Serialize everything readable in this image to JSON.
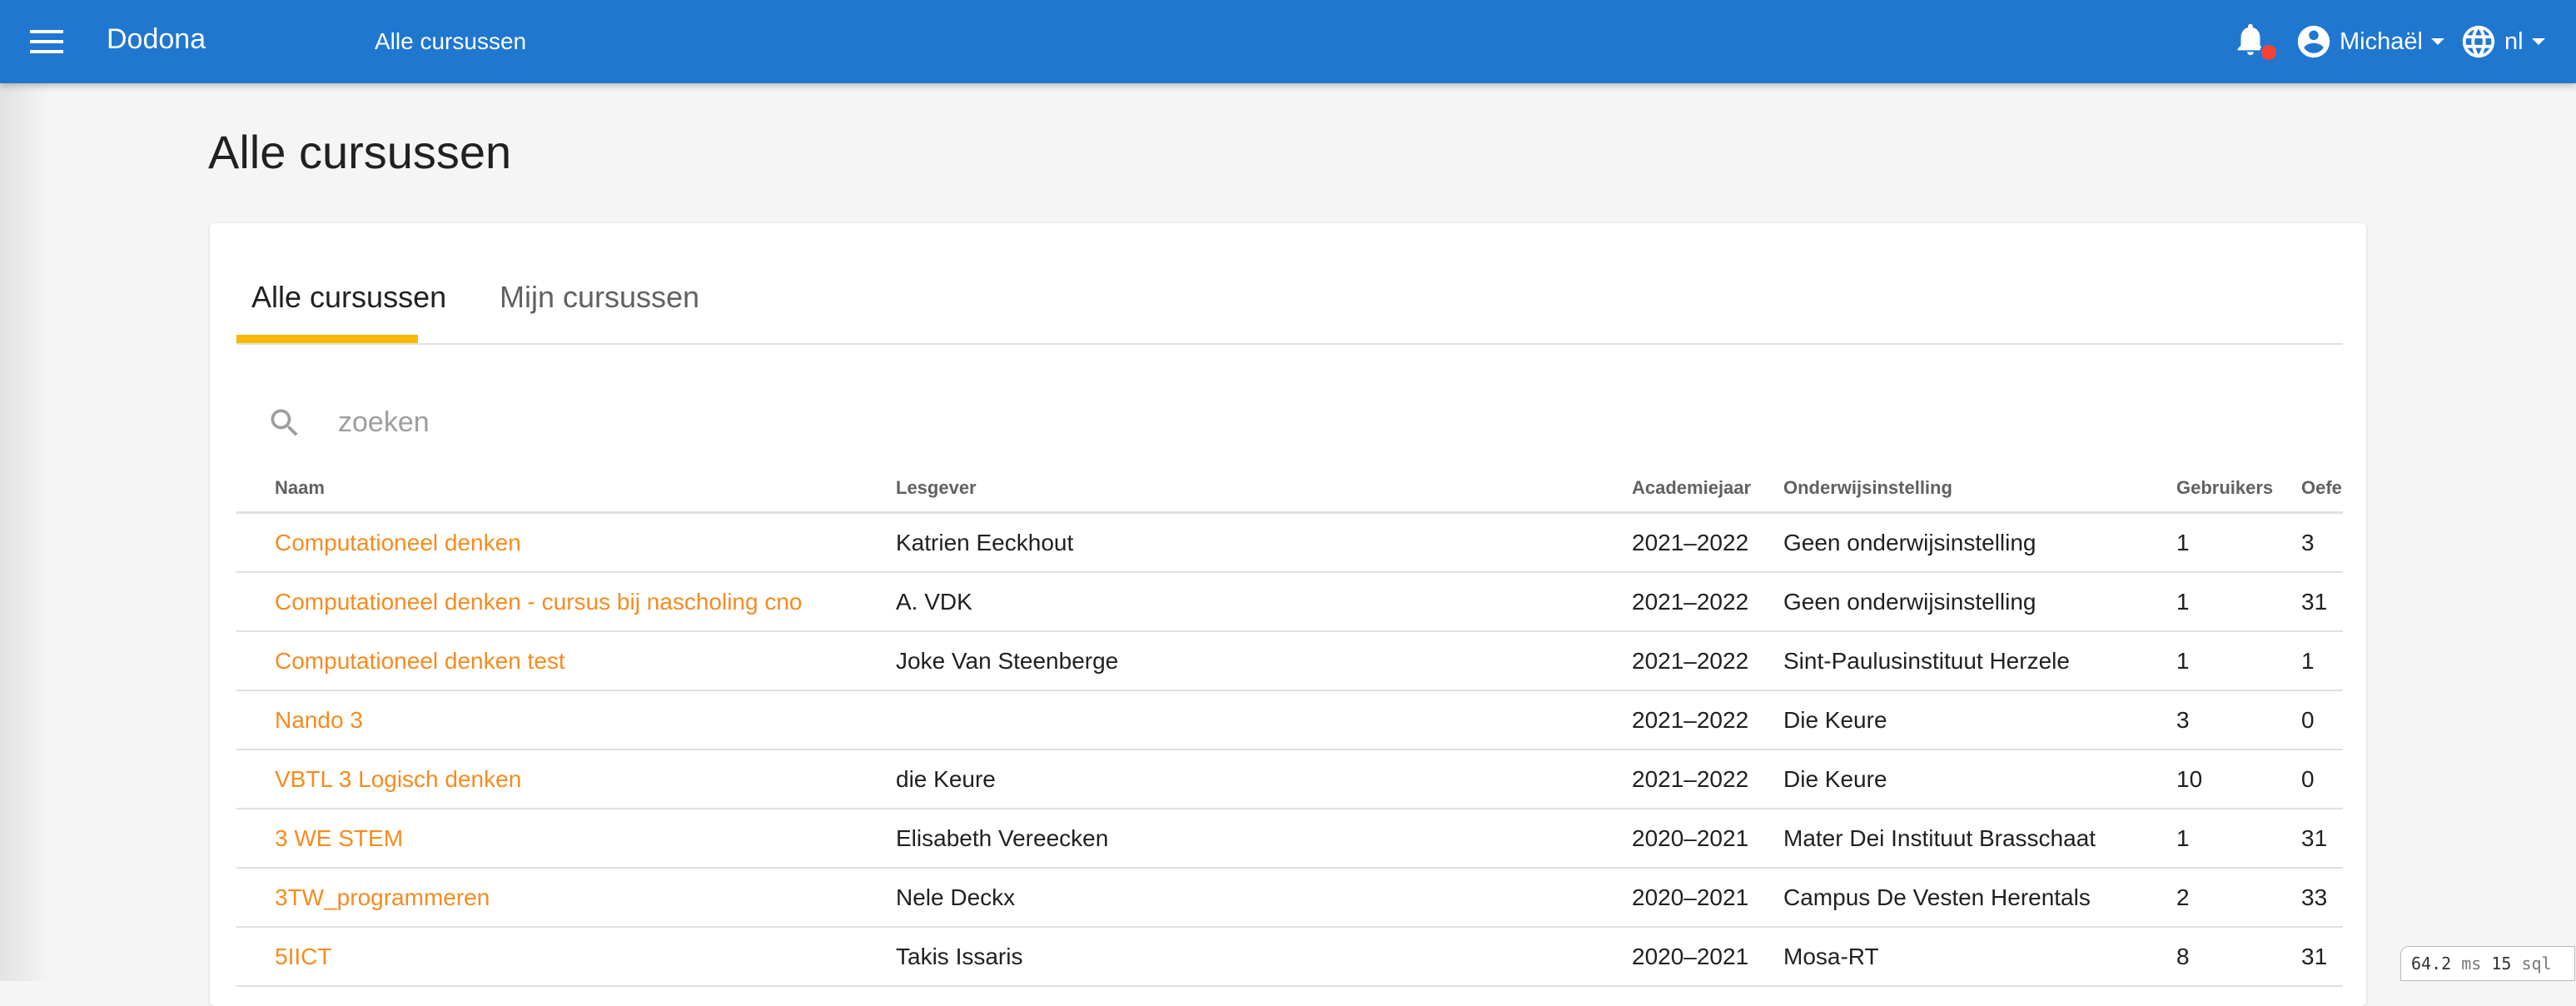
{
  "header": {
    "brand": "Dodona",
    "title": "Alle cursussen",
    "user_name": "Michaël",
    "language": "nl",
    "bar_color": "#1f77d0",
    "icons": [
      "menu-icon",
      "bell-icon",
      "account-circle-icon",
      "globe-icon"
    ]
  },
  "page": {
    "title": "Alle cursussen"
  },
  "tabs": [
    {
      "label": "Alle cursussen",
      "active": true
    },
    {
      "label": "Mijn cursussen",
      "active": false
    }
  ],
  "search": {
    "placeholder": "zoeken",
    "value": ""
  },
  "table": {
    "columns": [
      "Naam",
      "Lesgever",
      "Academiejaar",
      "Onderwijsinstelling",
      "Gebruikers",
      "Oefe"
    ],
    "rows": [
      [
        "Computationeel denken",
        "Katrien Eeckhout",
        "2021–2022",
        "Geen onderwijsinstelling",
        "1",
        "3"
      ],
      [
        "Computationeel denken - cursus bij nascholing cno",
        "A. VDK",
        "2021–2022",
        "Geen onderwijsinstelling",
        "1",
        "31"
      ],
      [
        "Computationeel denken test",
        "Joke Van Steenberge",
        "2021–2022",
        "Sint-Paulusinstituut Herzele",
        "1",
        "1"
      ],
      [
        "Nando 3",
        "",
        "2021–2022",
        "Die Keure",
        "3",
        "0"
      ],
      [
        "VBTL 3 Logisch denken",
        "die Keure",
        "2021–2022",
        "Die Keure",
        "10",
        "0"
      ],
      [
        "3 WE STEM",
        "Elisabeth Vereecken",
        "2020–2021",
        "Mater Dei Instituut Brasschaat",
        "1",
        "31"
      ],
      [
        "3TW_programmeren",
        "Nele Deckx",
        "2020–2021",
        "Campus De Vesten Herentals",
        "2",
        "33"
      ],
      [
        "5IICT",
        "Takis Issaris",
        "2020–2021",
        "Mosa-RT",
        "8",
        "31"
      ]
    ]
  },
  "perf": {
    "ms": "64.2",
    "ms_unit": "ms",
    "sql": "15",
    "sql_unit": "sql"
  },
  "colors": {
    "link": "#f68b1f",
    "tab_indicator": "#f6b900",
    "notification": "#f44336"
  }
}
